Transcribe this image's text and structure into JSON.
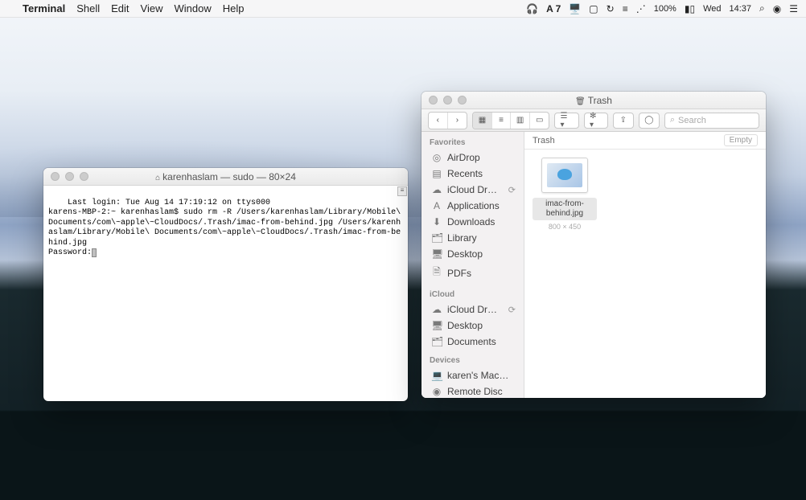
{
  "menubar": {
    "app": "Terminal",
    "items": [
      "Shell",
      "Edit",
      "View",
      "Window",
      "Help"
    ],
    "right": {
      "adobe_label": "A",
      "adobe_count": "7",
      "battery": "100%",
      "day": "Wed",
      "time": "14:37"
    }
  },
  "terminal": {
    "title": "karenhaslam — sudo — 80×24",
    "home_glyph": "⌂",
    "lines": [
      "Last login: Tue Aug 14 17:19:12 on ttys000",
      "karens-MBP-2:~ karenhaslam$ sudo rm -R /Users/karenhaslam/Library/Mobile\\ Documents/com\\~apple\\~CloudDocs/.Trash/imac-from-behind.jpg /Users/karenhaslam/Library/Mobile\\ Documents/com\\~apple\\~CloudDocs/.Trash/imac-from-behind.jpg",
      "Password:"
    ]
  },
  "finder": {
    "title": "Trash",
    "trash_glyph": "🗑",
    "toolbar": {
      "back": "‹",
      "fwd": "›",
      "view_icon": "▦",
      "view_list": "≡",
      "view_col": "▥",
      "view_gal": "▭",
      "group": "☰ ▾",
      "action": "✻ ▾",
      "share": "⇪",
      "tags": "◯",
      "search_icon": "⌕",
      "search_placeholder": "Search"
    },
    "pathbar": {
      "location": "Trash",
      "empty_label": "Empty"
    },
    "sidebar": {
      "sections": [
        {
          "header": "Favorites",
          "items": [
            {
              "icon": "◎",
              "label": "AirDrop"
            },
            {
              "icon": "▤",
              "label": "Recents"
            },
            {
              "icon": "☁",
              "label": "iCloud Dr…",
              "badge": "⟳"
            },
            {
              "icon": "A",
              "label": "Applications"
            },
            {
              "icon": "⬇",
              "label": "Downloads"
            },
            {
              "icon": "🗂",
              "label": "Library"
            },
            {
              "icon": "🖥",
              "label": "Desktop"
            },
            {
              "icon": "🗎",
              "label": "PDFs"
            }
          ]
        },
        {
          "header": "iCloud",
          "items": [
            {
              "icon": "☁",
              "label": "iCloud Dr…",
              "badge": "⟳"
            },
            {
              "icon": "🖥",
              "label": "Desktop"
            },
            {
              "icon": "🗂",
              "label": "Documents"
            }
          ]
        },
        {
          "header": "Devices",
          "items": [
            {
              "icon": "💻",
              "label": "karen's Mac…"
            },
            {
              "icon": "◉",
              "label": "Remote Disc"
            }
          ]
        }
      ]
    },
    "files": [
      {
        "name": "imac-from-behind.jpg",
        "dimensions": "800 × 450"
      }
    ]
  }
}
